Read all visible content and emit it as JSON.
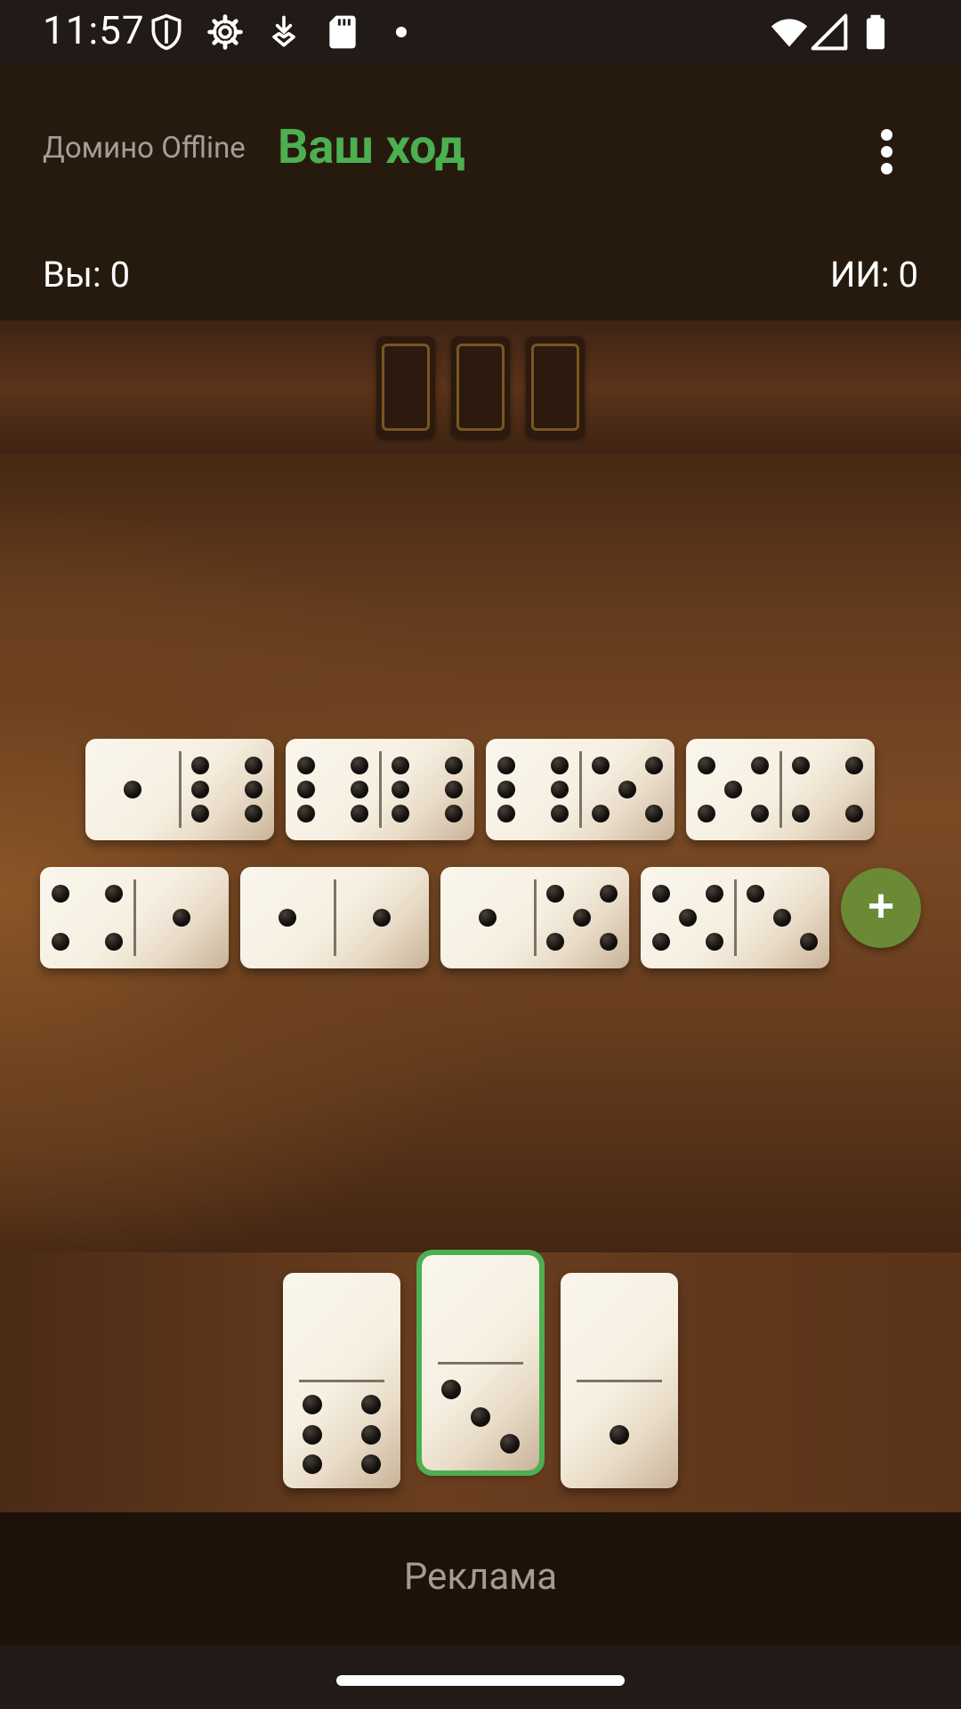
{
  "status_bar": {
    "time": "11:57",
    "icons": [
      "shield-icon",
      "settings-icon",
      "download-icon",
      "sd-card-icon",
      "notification-dot",
      "wifi-icon",
      "signal-icon",
      "battery-icon"
    ]
  },
  "header": {
    "app_name": "Домино Offline",
    "turn_label": "Ваш ход",
    "menu_icon": "more-vertical-icon"
  },
  "scores": {
    "you": "Вы: 0",
    "ai": "ИИ: 0"
  },
  "opponent": {
    "hidden_tiles": 3
  },
  "board": {
    "row1": [
      [
        1,
        6
      ],
      [
        6,
        6
      ],
      [
        6,
        5
      ],
      [
        5,
        4
      ]
    ],
    "row2": [
      [
        4,
        1
      ],
      [
        1,
        1
      ],
      [
        1,
        5
      ],
      [
        5,
        3
      ]
    ],
    "draw_button_label": "+"
  },
  "hand": {
    "tiles": [
      [
        0,
        6
      ],
      [
        0,
        3
      ],
      [
        0,
        1
      ]
    ],
    "selected_index": 1
  },
  "ad": {
    "label": "Реклама"
  },
  "colors": {
    "accent": "#4caf50",
    "draw_button": "#6b8a36",
    "header_bg": "#261a0e"
  }
}
